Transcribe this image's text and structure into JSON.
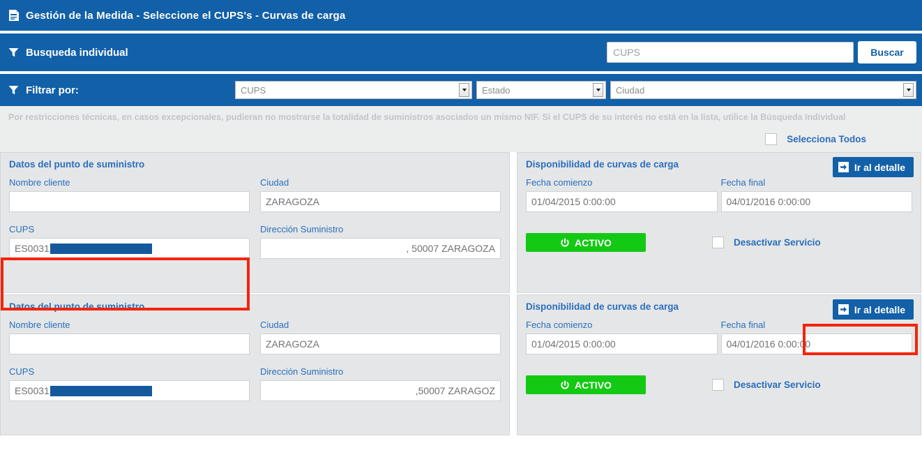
{
  "header": {
    "icon": "document-icon",
    "title": "Gestión de la Medida - Seleccione el CUPS's - Curvas de carga",
    "background_color": "#1260a8"
  },
  "individual_search": {
    "icon": "filter-icon",
    "label": "Busqueda individual",
    "input_placeholder": "CUPS",
    "input_value": "",
    "button_label": "Buscar"
  },
  "filter_bar": {
    "icon": "filter-icon",
    "label": "Filtrar por:",
    "selects": [
      {
        "name": "cups",
        "value": "CUPS"
      },
      {
        "name": "estado",
        "value": "Estado"
      },
      {
        "name": "ciudad",
        "value": "Ciudad"
      }
    ]
  },
  "notice": {
    "text": "Por restricciones técnicas, en casos excepcionales, pudieran no mostrarse la totalidad de suministros asociados un mismo NIF. Si el CUPS de su interés no está en la lista, utilice la Búsqueda Individual",
    "select_all_label": "Selecciona Todos",
    "select_all_checked": false
  },
  "labels": {
    "supply_point_header": "Datos del punto de suministro",
    "nombre_cliente": "Nombre cliente",
    "ciudad": "Ciudad",
    "cups": "CUPS",
    "direccion": "Dirección Suministro",
    "availability_header": "Disponibilidad de curvas de carga",
    "fecha_comienzo": "Fecha comienzo",
    "fecha_final": "Fecha final",
    "detail_button": "Ir al detalle",
    "activo_button": "ACTIVO",
    "desactivar": "Desactivar Servicio"
  },
  "cards": [
    {
      "nombre_cliente": "",
      "ciudad": "ZARAGOZA",
      "cups_prefix": "ES0031",
      "cups_redacted_width": 146,
      "direccion": ", 50007 ZARAGOZA",
      "fecha_comienzo": "01/04/2015 0:00:00",
      "fecha_final": "04/01/2016 0:00:00",
      "estado_servicio": "ACTIVO",
      "desactivar_checked": false
    },
    {
      "nombre_cliente": "",
      "ciudad": "ZARAGOZA",
      "cups_prefix": "ES0031",
      "cups_redacted_width": 146,
      "direccion": ",50007 ZARAGOZ",
      "fecha_comienzo": "01/04/2015 0:00:00",
      "fecha_final": "04/01/2016 0:00:00",
      "estado_servicio": "ACTIVO",
      "desactivar_checked": false
    }
  ],
  "annotations": {
    "color": "#f3250c",
    "boxes": [
      {
        "name": "cups-field-highlight",
        "target": "card 1 CUPS field"
      },
      {
        "name": "detail-button-highlight",
        "target": "card 2 Ir al detalle button"
      }
    ]
  }
}
